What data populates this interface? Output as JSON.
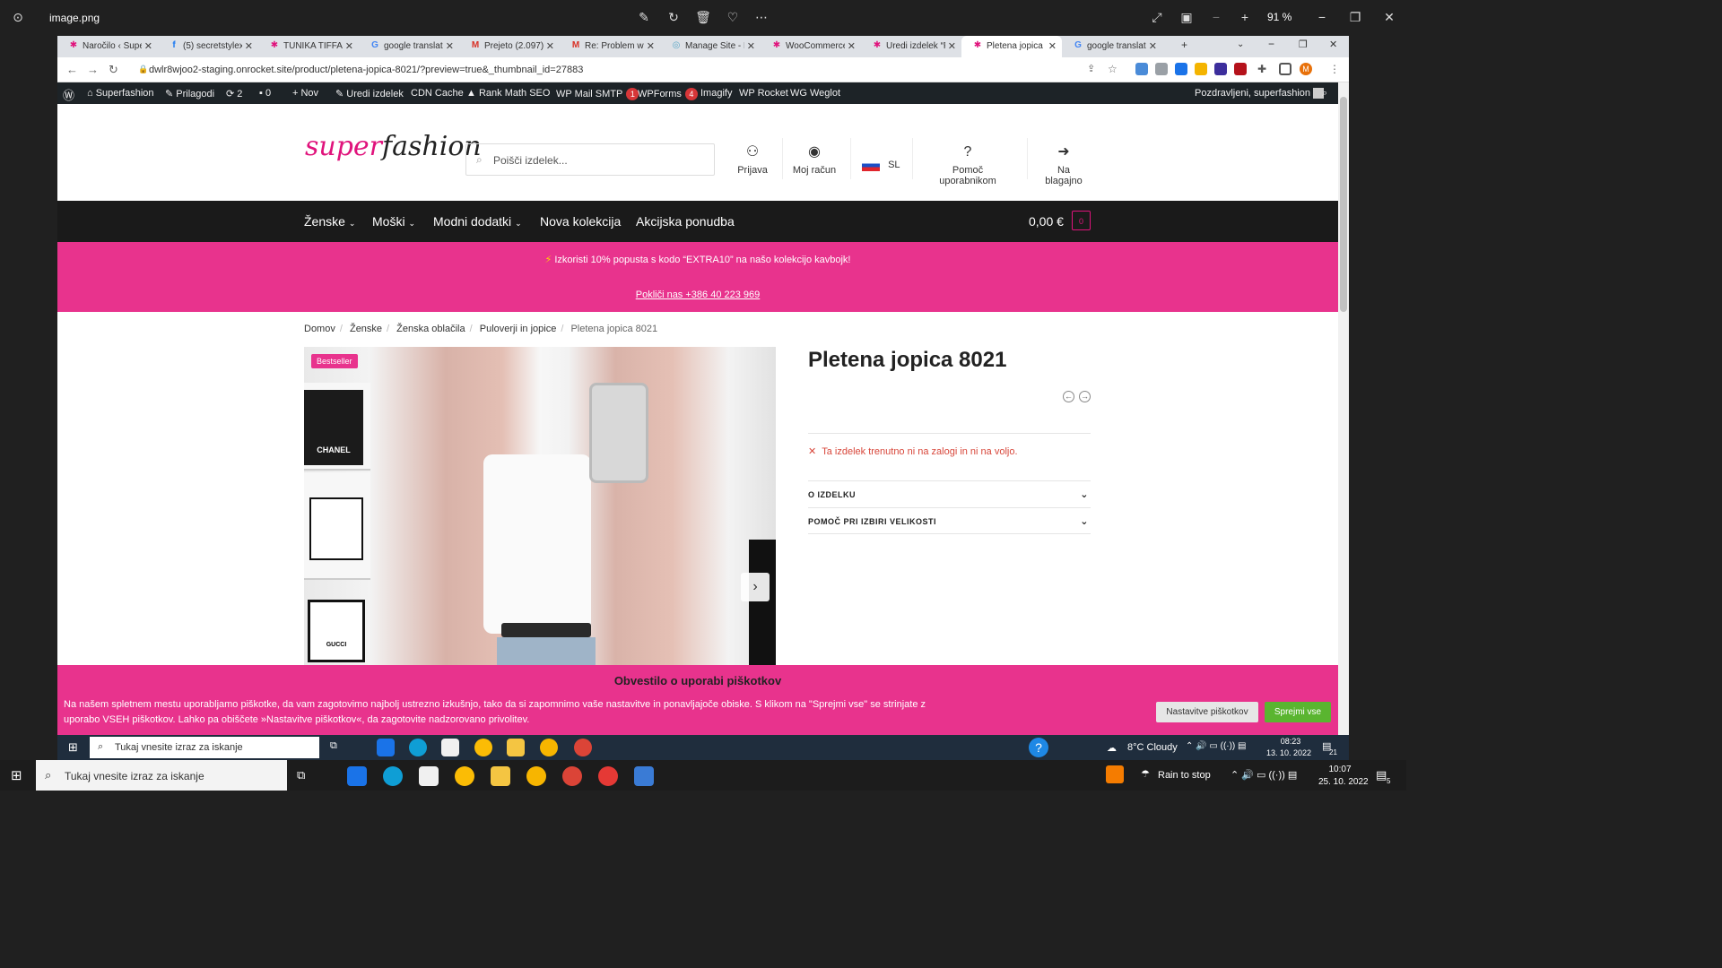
{
  "viewer": {
    "title": "image.png",
    "zoom": "91 %"
  },
  "tabs": [
    {
      "label": "Naročilo ‹ Super",
      "fav": "✱",
      "color": "#e0137c"
    },
    {
      "label": "(5) secretstylex",
      "fav": "f",
      "color": "#1877f2"
    },
    {
      "label": "TUNIKA TIFFANY",
      "fav": "✱",
      "color": "#e0137c"
    },
    {
      "label": "google translate",
      "fav": "G",
      "color": "#4285f4"
    },
    {
      "label": "Prejeto (2.097) -",
      "fav": "M",
      "color": "#d93025"
    },
    {
      "label": "Re: Problem with",
      "fav": "M",
      "color": "#d93025"
    },
    {
      "label": "Manage Site - R",
      "fav": "◎",
      "color": "#5aa7c7"
    },
    {
      "label": "WooCommerce",
      "fav": "✱",
      "color": "#e0137c"
    },
    {
      "label": "Uredi izdelek “P",
      "fav": "✱",
      "color": "#e0137c"
    },
    {
      "label": "Pletena jopica 8",
      "fav": "✱",
      "color": "#e0137c"
    },
    {
      "label": "google translate",
      "fav": "G",
      "color": "#4285f4"
    }
  ],
  "address": {
    "url": "dwlr8wjoo2-staging.onrocket.site/product/pletena-jopica-8021/?preview=true&_thumbnail_id=27883"
  },
  "adminbar": {
    "site": "Superfashion",
    "customize": "Prilagodi",
    "updates": "2",
    "comments": "0",
    "new": "Nov",
    "edit": "Uredi izdelek",
    "cdn": "CDN Cache",
    "rankmath": "Rank Math SEO",
    "smtp": "WP Mail SMTP",
    "smtp_badge": "1",
    "wpforms": "WPForms",
    "wpforms_badge": "4",
    "imagify": "Imagify",
    "rocket": "WP Rocket",
    "weglot": "Weglot",
    "greeting": "Pozdravljeni, superfashion"
  },
  "header": {
    "logo_super": "super",
    "logo_fashion": "fashion",
    "search_placeholder": "Poišči izdelek...",
    "login": "Prijava",
    "account": "Moj račun",
    "lang": "SL",
    "help": "Pomoč uporabnikom",
    "checkout": "Na blagajno"
  },
  "nav": {
    "items": [
      "Ženske",
      "Moški",
      "Modni dodatki",
      "Nova kolekcija",
      "Akcijska ponudba"
    ],
    "cart_total": "0,00 €",
    "cart_count": "0"
  },
  "promo": {
    "line1": "Izkoristi 10% popusta s kodo “EXTRA10” na našo kolekcijo kavbojk!",
    "line2": "Pokliči nas +386 40 223 969"
  },
  "breadcrumb": [
    "Domov",
    "Ženske",
    "Ženska oblačila",
    "Puloverji in jopice",
    "Pletena jopica 8021"
  ],
  "product": {
    "badge": "Bestseller",
    "photo_text_chanel": "CHANEL",
    "photo_text_gucci": "GUCCI",
    "title": "Pletena jopica 8021",
    "stock": "Ta izdelek trenutno ni na zalogi in ni na voljo.",
    "accordion": [
      "O IZDELKU",
      "POMOČ PRI IZBIRI VELIKOSTI"
    ]
  },
  "cookie": {
    "title": "Obvestilo o uporabi piškotkov",
    "text": "Na našem spletnem mestu uporabljamo piškotke, da vam zagotovimo najbolj ustrezno izkušnjo, tako da si zapomnimo vaše nastavitve in ponavljajoče obiske. S klikom na \"Sprejmi vse\" se strinjate z uporabo VSEH piškotkov. Lahko pa obiščete »Nastavitve piškotkov«, da zagotovite nadzorovano privolitev.",
    "settings": "Nastavitve piškotkov",
    "accept": "Sprejmi vse"
  },
  "inner_taskbar": {
    "search": "Tukaj vnesite izraz za iskanje",
    "weather": "8°C Cloudy",
    "time": "08:23",
    "date": "13. 10. 2022",
    "notif": "21"
  },
  "taskbar": {
    "search": "Tukaj vnesite izraz za iskanje",
    "weather": "Rain to stop",
    "time": "10:07",
    "date": "25. 10. 2022",
    "notif": "5"
  },
  "colors": {
    "brand_pink": "#e8338d",
    "dark_nav": "#1a1a1a",
    "accept_green": "#5ab530",
    "stock_red": "#d8473b"
  }
}
